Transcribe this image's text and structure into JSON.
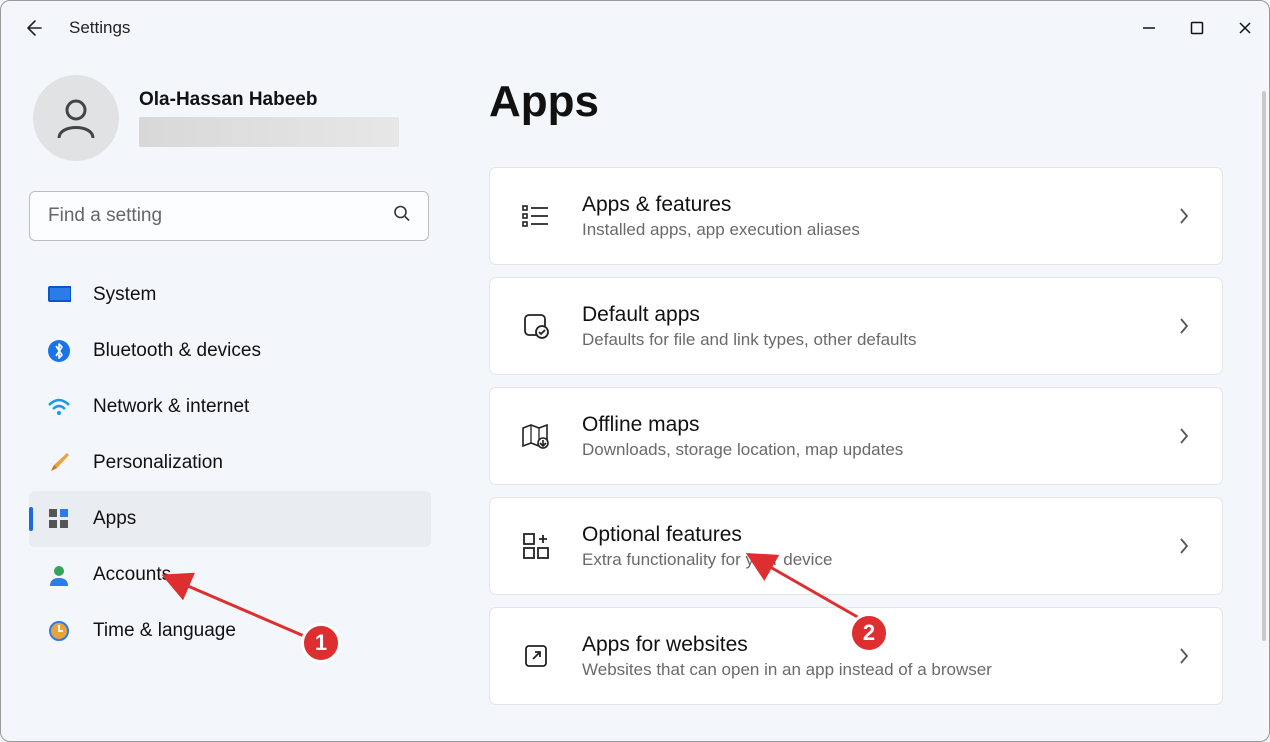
{
  "app": {
    "title": "Settings"
  },
  "profile": {
    "name": "Ola-Hassan Habeeb"
  },
  "search": {
    "placeholder": "Find a setting"
  },
  "nav": {
    "items": [
      {
        "id": "system",
        "label": "System"
      },
      {
        "id": "bluetooth",
        "label": "Bluetooth & devices"
      },
      {
        "id": "network",
        "label": "Network & internet"
      },
      {
        "id": "personalization",
        "label": "Personalization"
      },
      {
        "id": "apps",
        "label": "Apps"
      },
      {
        "id": "accounts",
        "label": "Accounts"
      },
      {
        "id": "time",
        "label": "Time & language"
      }
    ]
  },
  "page": {
    "title": "Apps"
  },
  "cards": [
    {
      "id": "apps-features",
      "title": "Apps & features",
      "sub": "Installed apps, app execution aliases"
    },
    {
      "id": "default-apps",
      "title": "Default apps",
      "sub": "Defaults for file and link types, other defaults"
    },
    {
      "id": "offline-maps",
      "title": "Offline maps",
      "sub": "Downloads, storage location, map updates"
    },
    {
      "id": "optional-features",
      "title": "Optional features",
      "sub": "Extra functionality for your device"
    },
    {
      "id": "apps-websites",
      "title": "Apps for websites",
      "sub": "Websites that can open in an app instead of a browser"
    }
  ],
  "annotations": {
    "badge1": "1",
    "badge2": "2"
  }
}
